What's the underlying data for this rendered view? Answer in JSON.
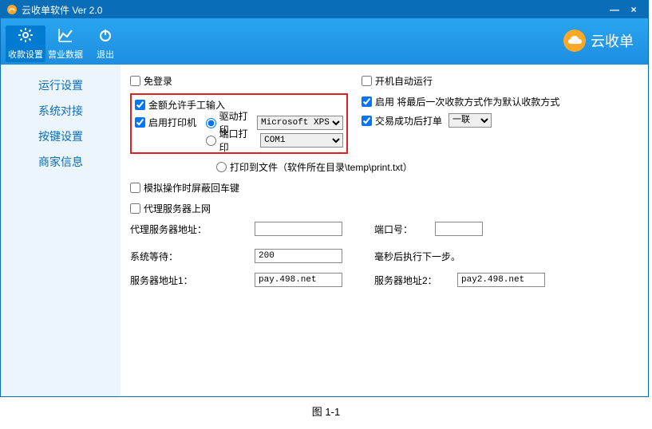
{
  "window": {
    "title": "云收单软件 Ver 2.0",
    "min": "—",
    "close": "×"
  },
  "ribbon": {
    "tabs": [
      {
        "icon": "✿",
        "label": "收款设置"
      },
      {
        "icon": "～",
        "label": "营业数据"
      },
      {
        "icon": "⏻",
        "label": "退出"
      }
    ],
    "brand": "云收单"
  },
  "sidebar": {
    "items": [
      "运行设置",
      "系统对接",
      "按键设置",
      "商家信息"
    ]
  },
  "settings": {
    "free_login": "免登录",
    "auto_start": "开机自动运行",
    "manual_amount": "金额允许手工输入",
    "enable_default_pay": "启用 将最后一次收款方式作为默认收款方式",
    "enable_printer": "启用打印机",
    "driver_print": "驱动打印",
    "port_print": "端口打印",
    "printer_select": "Microsoft XPS D",
    "port_select": "COM1",
    "print_on_success": "交易成功后打单",
    "copies_select": "一联",
    "print_to_file": "打印到文件（软件所在目录\\temp\\print.txt）",
    "block_enter": "模拟操作时屏蔽回车键",
    "proxy_online": "代理服务器上网",
    "proxy_addr_label": "代理服务器地址：",
    "port_label": "端口号：",
    "wait_label": "系统等待：",
    "wait_value": "200",
    "wait_suffix": "毫秒后执行下一步。",
    "server1_label": "服务器地址1：",
    "server1_value": "pay.498.net",
    "server2_label": "服务器地址2：",
    "server2_value": "pay2.498.net",
    "proxy_addr_value": "",
    "port_value": ""
  },
  "caption": "图 1-1"
}
